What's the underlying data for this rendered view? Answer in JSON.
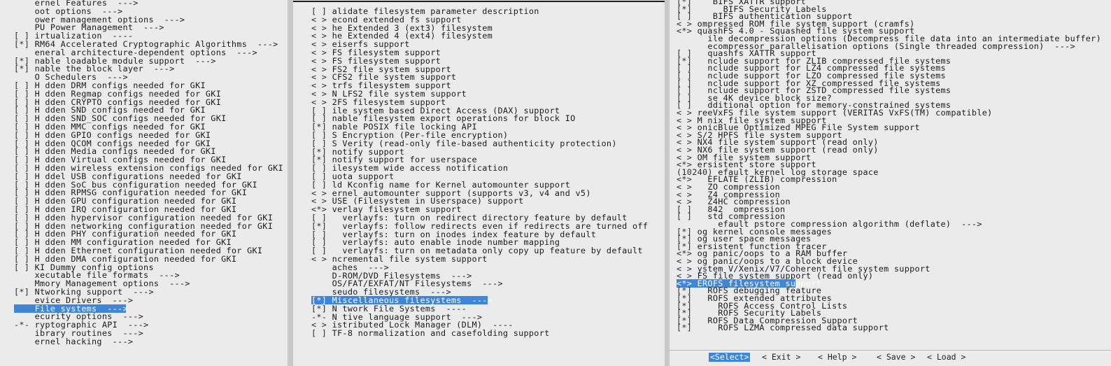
{
  "left_pane": {
    "rows": [
      {
        "tag": "    ",
        "text": "ernel Features  --->",
        "y": -5
      },
      {
        "tag": "    ",
        "text": "oot options  --->"
      },
      {
        "tag": "    ",
        "text": "ower management options  --->"
      },
      {
        "tag": "    ",
        "text": "PU Power Management  --->"
      },
      {
        "tag": "[ ] ",
        "text": "irtualization  ----"
      },
      {
        "tag": "[*] ",
        "text": "RM64 Accelerated Cryptographic Algorithms  --->"
      },
      {
        "tag": "    ",
        "text": "eneral architecture-dependent options  --->"
      },
      {
        "tag": "[*] ",
        "text": "nable loadable module support  --->"
      },
      {
        "tag": "[*] ",
        "text": "nable the block layer  --->"
      },
      {
        "tag": "    ",
        "text": "O Schedulers  --->"
      },
      {
        "tag": "[ ] ",
        "text": "H dden DRM configs needed for GKI"
      },
      {
        "tag": "[ ] ",
        "text": "H dden Regmap configs needed for GKI"
      },
      {
        "tag": "[ ] ",
        "text": "H dden CRYPTO configs needed for GKI"
      },
      {
        "tag": "[ ] ",
        "text": "H dden SND configs needed for GKI"
      },
      {
        "tag": "[ ] ",
        "text": "H dden SND_SOC configs needed for GKI"
      },
      {
        "tag": "[ ] ",
        "text": "H dden MMC configs needed for GKI"
      },
      {
        "tag": "[ ] ",
        "text": "H dden GPIO configs needed for GKI"
      },
      {
        "tag": "[ ] ",
        "text": "H dden QCOM configs needed for GKI"
      },
      {
        "tag": "[ ] ",
        "text": "H dden Media configs needed for GKI"
      },
      {
        "tag": "[ ] ",
        "text": "H dden Virtual configs needed for GKI"
      },
      {
        "tag": "[ ] ",
        "text": "H dden wireless extension configs needed for GKI"
      },
      {
        "tag": "[ ] ",
        "text": "H ddel USB configurations needed for GKI"
      },
      {
        "tag": "[ ] ",
        "text": "H dden SoC bus configuration needed for GKI"
      },
      {
        "tag": "[ ] ",
        "text": "H dden RPMSG configuration needed for GKI"
      },
      {
        "tag": "[ ] ",
        "text": "H dden GPU configuration needed for GKI"
      },
      {
        "tag": "[ ] ",
        "text": "H dden IRQ configuration needed for GKI"
      },
      {
        "tag": "[ ] ",
        "text": "H dden hypervisor configuration needed for GKI"
      },
      {
        "tag": "[ ] ",
        "text": "H dden networking configuration needed for GKI"
      },
      {
        "tag": "[ ] ",
        "text": "H dden PHY configuration needed for GKI"
      },
      {
        "tag": "[ ] ",
        "text": "H dden MM configuration needed for GKI"
      },
      {
        "tag": "[ ] ",
        "text": "H dden Ethernet configuration needed for GKI"
      },
      {
        "tag": "[ ] ",
        "text": "H dden DMA configuration needed for GKI"
      },
      {
        "tag": "[ ] ",
        "text": "KI Dummy config options"
      },
      {
        "tag": "    ",
        "text": "xecutable file formats  --->"
      },
      {
        "tag": "    ",
        "text": "Mmory Management options  --->"
      },
      {
        "tag": "[*] ",
        "text": "Ntworking support  --->"
      },
      {
        "tag": "    ",
        "text": "evice Drivers  --->"
      },
      {
        "tag": "    ",
        "text": "File systems  --->",
        "selected": true
      },
      {
        "tag": "    ",
        "text": "ecurity options  --->"
      },
      {
        "tag": "-*- ",
        "text": "ryptographic API  --->"
      },
      {
        "tag": "    ",
        "text": "ibrary routines  --->"
      },
      {
        "tag": "    ",
        "text": "ernel hacking  --->"
      }
    ]
  },
  "mid_pane": {
    "rows": [
      {
        "tag": "[ ] ",
        "text": "alidate filesystem parameter description"
      },
      {
        "tag": "< > ",
        "text": "econd extended fs support"
      },
      {
        "tag": "< > ",
        "text": "he Extended 3 (ext3) filesystem"
      },
      {
        "tag": "< > ",
        "text": "he Extended 4 (ext4) filesystem"
      },
      {
        "tag": "< > ",
        "text": "eiserfs support"
      },
      {
        "tag": "< > ",
        "text": "FS filesystem support"
      },
      {
        "tag": "< > ",
        "text": "FS filesystem support"
      },
      {
        "tag": "< > ",
        "text": "FS2 file system support"
      },
      {
        "tag": "< > ",
        "text": "CFS2 file system support"
      },
      {
        "tag": "< > ",
        "text": "trfs filesystem support"
      },
      {
        "tag": "< > ",
        "text": "N LFS2 file system support"
      },
      {
        "tag": "< > ",
        "text": "2FS filesystem support"
      },
      {
        "tag": "[ ] ",
        "text": "ile system based Direct Access (DAX) support"
      },
      {
        "tag": "[ ] ",
        "text": "nable filesystem export operations for block IO"
      },
      {
        "tag": "[*] ",
        "text": "nable POSIX file locking API"
      },
      {
        "tag": "[ ] ",
        "text": "S Encryption (Per-file encryption)"
      },
      {
        "tag": "[ ] ",
        "text": "S Verity (read-only file-based authenticity protection)"
      },
      {
        "tag": "[*] ",
        "text": "notify support"
      },
      {
        "tag": "[*] ",
        "text": "notify support for userspace"
      },
      {
        "tag": "[ ] ",
        "text": "ilesystem wide access notification"
      },
      {
        "tag": "[ ] ",
        "text": "uota support"
      },
      {
        "tag": "[ ] ",
        "text": "ld Kconfig name for Kernel automounter support"
      },
      {
        "tag": "< > ",
        "text": "ernel automounter support (supports v3, v4 and v5)"
      },
      {
        "tag": "< > ",
        "text": "USE (Filesystem in Userspace) support"
      },
      {
        "tag": "<*> ",
        "text": "verlay filesystem support"
      },
      {
        "tag": "[ ] ",
        "text": "  verlayfs: turn on redirect directory feature by default"
      },
      {
        "tag": "[*] ",
        "text": "  verlayfs: follow redirects even if redirects are turned off"
      },
      {
        "tag": "[ ] ",
        "text": "  verlayfs: turn on inodes index feature by default"
      },
      {
        "tag": "[ ] ",
        "text": "  verlayfs: auto enable inode number mapping"
      },
      {
        "tag": "[ ] ",
        "text": "  verlayfs: turn on metadata only copy up feature by default"
      },
      {
        "tag": "< > ",
        "text": "ncremental file system support"
      },
      {
        "tag": "    ",
        "text": "aches  --->"
      },
      {
        "tag": "    ",
        "text": "D-ROM/DVD Filesystems  --->"
      },
      {
        "tag": "    ",
        "text": "OS/FAT/EXFAT/NT Filesystems  --->"
      },
      {
        "tag": "    ",
        "text": "seudo filesystems  --->"
      },
      {
        "tag": "[*] ",
        "text": "Miscellaneous filesystems  --->",
        "selected": true
      },
      {
        "tag": "[*] ",
        "text": "N twork File Systems  ----"
      },
      {
        "tag": "-*- ",
        "text": "N tive language support  --->"
      },
      {
        "tag": "< > ",
        "text": "istributed Lock Manager (DLM)  ----"
      },
      {
        "tag": "[ ] ",
        "text": "TF-8 normalization and casefolding support"
      }
    ]
  },
  "right_pane": {
    "rows": [
      {
        "tag": "[*] ",
        "text": "   BIFS XATTR support"
      },
      {
        "tag": "[*] ",
        "text": "     BIFS Security Labels"
      },
      {
        "tag": "[ ] ",
        "text": "   BIFS authentication support"
      },
      {
        "tag": "< > ",
        "text": "ompressed ROM file system support (cramfs)"
      },
      {
        "tag": "<*> ",
        "text": "quashFS 4.0 - Squashed file system support"
      },
      {
        "tag": "    ",
        "text": "  ile decompression options (Decompress file data into an intermediate buffer)  --->"
      },
      {
        "tag": "    ",
        "text": "  ecompressor parallelisation options (Single threaded compression)  --->"
      },
      {
        "tag": "[ ] ",
        "text": "  quashfs XATTR support"
      },
      {
        "tag": "[*] ",
        "text": "  nclude support for ZLIB compressed file systems"
      },
      {
        "tag": "[ ] ",
        "text": "  nclude support for LZ4 compressed file systems"
      },
      {
        "tag": "[ ] ",
        "text": "  nclude support for LZO compressed file systems"
      },
      {
        "tag": "[ ] ",
        "text": "  nclude support for XZ compressed file systems"
      },
      {
        "tag": "[ ] ",
        "text": "  nclude support for ZSTD compressed file systems"
      },
      {
        "tag": "[ ] ",
        "text": "  se 4K device block size?"
      },
      {
        "tag": "[ ] ",
        "text": "  dditional option for memory-constrained systems"
      },
      {
        "tag": "< > ",
        "text": "reeVxFS file system support (VERITAS VxFS(TM) compatible)"
      },
      {
        "tag": "< > ",
        "text": "M nix file system support"
      },
      {
        "tag": "< > ",
        "text": "onicBlue Optimized MPEG File System support"
      },
      {
        "tag": "< > ",
        "text": "S/2 HPFS file system support"
      },
      {
        "tag": "< > ",
        "text": "NX4 file system support (read only)"
      },
      {
        "tag": "< > ",
        "text": "NX6 file system support (read only)"
      },
      {
        "tag": "< > ",
        "text": "OM file system support"
      },
      {
        "tag": "<*> ",
        "text": "ersistent store support"
      },
      {
        "tag": "(10240) ",
        "text": "efault kernel log storage space"
      },
      {
        "tag": "<*> ",
        "text": "  EFLATE (ZLIB) compression"
      },
      {
        "tag": "< > ",
        "text": "  ZO compression"
      },
      {
        "tag": "< > ",
        "text": "  Z4 compression"
      },
      {
        "tag": "< > ",
        "text": "  Z4HC compression"
      },
      {
        "tag": "[ ] ",
        "text": "  842  ompression"
      },
      {
        "tag": "[ ] ",
        "text": "  std compression"
      },
      {
        "tag": "    ",
        "text": "    efault pstore compression algorithm (deflate)  --->"
      },
      {
        "tag": "[*] ",
        "text": "og kernel console messages"
      },
      {
        "tag": "[*] ",
        "text": "og user space messages"
      },
      {
        "tag": "[*] ",
        "text": "ersistent function tracer"
      },
      {
        "tag": "<*> ",
        "text": "og panic/oops to a RAM buffer"
      },
      {
        "tag": "< > ",
        "text": "og panic/oops to a block device"
      },
      {
        "tag": "< > ",
        "text": "ystem V/Xenix/V7/Coherent file system support"
      },
      {
        "tag": "< > ",
        "text": "FS file system support (read only)"
      },
      {
        "tag": "<*> ",
        "text": "EROFS filesystem support",
        "selected": true
      },
      {
        "tag": "[*] ",
        "text": "  ROFS debugging feature"
      },
      {
        "tag": "[*] ",
        "text": "  ROFS extended attributes"
      },
      {
        "tag": "[*] ",
        "text": "    ROFS Access Control Lists"
      },
      {
        "tag": "[*] ",
        "text": "    ROFS Security Labels"
      },
      {
        "tag": "[*] ",
        "text": "  ROFS Data Compression Support"
      },
      {
        "tag": "[*] ",
        "text": "    ROFS LZMA compressed data support"
      }
    ]
  },
  "buttons": [
    {
      "label": "<Select>",
      "hot": "",
      "active": true
    },
    {
      "label": "< Exit >",
      "hot": "E"
    },
    {
      "label": "< Help >",
      "hot": "H"
    },
    {
      "label": "< Save >",
      "hot": "S"
    },
    {
      "label": "< Load >",
      "hot": "L"
    }
  ]
}
